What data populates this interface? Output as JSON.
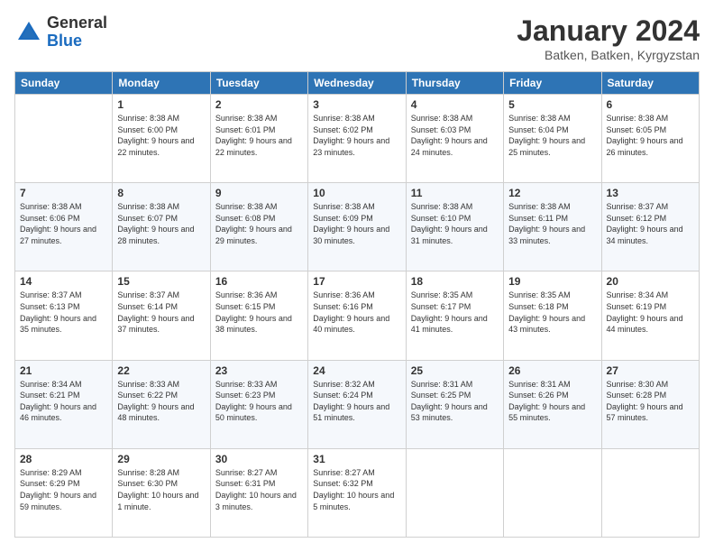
{
  "logo": {
    "general": "General",
    "blue": "Blue"
  },
  "header": {
    "title": "January 2024",
    "location": "Batken, Batken, Kyrgyzstan"
  },
  "weekdays": [
    "Sunday",
    "Monday",
    "Tuesday",
    "Wednesday",
    "Thursday",
    "Friday",
    "Saturday"
  ],
  "weeks": [
    [
      {
        "day": "",
        "sunrise": "",
        "sunset": "",
        "daylight": ""
      },
      {
        "day": "1",
        "sunrise": "Sunrise: 8:38 AM",
        "sunset": "Sunset: 6:00 PM",
        "daylight": "Daylight: 9 hours and 22 minutes."
      },
      {
        "day": "2",
        "sunrise": "Sunrise: 8:38 AM",
        "sunset": "Sunset: 6:01 PM",
        "daylight": "Daylight: 9 hours and 22 minutes."
      },
      {
        "day": "3",
        "sunrise": "Sunrise: 8:38 AM",
        "sunset": "Sunset: 6:02 PM",
        "daylight": "Daylight: 9 hours and 23 minutes."
      },
      {
        "day": "4",
        "sunrise": "Sunrise: 8:38 AM",
        "sunset": "Sunset: 6:03 PM",
        "daylight": "Daylight: 9 hours and 24 minutes."
      },
      {
        "day": "5",
        "sunrise": "Sunrise: 8:38 AM",
        "sunset": "Sunset: 6:04 PM",
        "daylight": "Daylight: 9 hours and 25 minutes."
      },
      {
        "day": "6",
        "sunrise": "Sunrise: 8:38 AM",
        "sunset": "Sunset: 6:05 PM",
        "daylight": "Daylight: 9 hours and 26 minutes."
      }
    ],
    [
      {
        "day": "7",
        "sunrise": "Sunrise: 8:38 AM",
        "sunset": "Sunset: 6:06 PM",
        "daylight": "Daylight: 9 hours and 27 minutes."
      },
      {
        "day": "8",
        "sunrise": "Sunrise: 8:38 AM",
        "sunset": "Sunset: 6:07 PM",
        "daylight": "Daylight: 9 hours and 28 minutes."
      },
      {
        "day": "9",
        "sunrise": "Sunrise: 8:38 AM",
        "sunset": "Sunset: 6:08 PM",
        "daylight": "Daylight: 9 hours and 29 minutes."
      },
      {
        "day": "10",
        "sunrise": "Sunrise: 8:38 AM",
        "sunset": "Sunset: 6:09 PM",
        "daylight": "Daylight: 9 hours and 30 minutes."
      },
      {
        "day": "11",
        "sunrise": "Sunrise: 8:38 AM",
        "sunset": "Sunset: 6:10 PM",
        "daylight": "Daylight: 9 hours and 31 minutes."
      },
      {
        "day": "12",
        "sunrise": "Sunrise: 8:38 AM",
        "sunset": "Sunset: 6:11 PM",
        "daylight": "Daylight: 9 hours and 33 minutes."
      },
      {
        "day": "13",
        "sunrise": "Sunrise: 8:37 AM",
        "sunset": "Sunset: 6:12 PM",
        "daylight": "Daylight: 9 hours and 34 minutes."
      }
    ],
    [
      {
        "day": "14",
        "sunrise": "Sunrise: 8:37 AM",
        "sunset": "Sunset: 6:13 PM",
        "daylight": "Daylight: 9 hours and 35 minutes."
      },
      {
        "day": "15",
        "sunrise": "Sunrise: 8:37 AM",
        "sunset": "Sunset: 6:14 PM",
        "daylight": "Daylight: 9 hours and 37 minutes."
      },
      {
        "day": "16",
        "sunrise": "Sunrise: 8:36 AM",
        "sunset": "Sunset: 6:15 PM",
        "daylight": "Daylight: 9 hours and 38 minutes."
      },
      {
        "day": "17",
        "sunrise": "Sunrise: 8:36 AM",
        "sunset": "Sunset: 6:16 PM",
        "daylight": "Daylight: 9 hours and 40 minutes."
      },
      {
        "day": "18",
        "sunrise": "Sunrise: 8:35 AM",
        "sunset": "Sunset: 6:17 PM",
        "daylight": "Daylight: 9 hours and 41 minutes."
      },
      {
        "day": "19",
        "sunrise": "Sunrise: 8:35 AM",
        "sunset": "Sunset: 6:18 PM",
        "daylight": "Daylight: 9 hours and 43 minutes."
      },
      {
        "day": "20",
        "sunrise": "Sunrise: 8:34 AM",
        "sunset": "Sunset: 6:19 PM",
        "daylight": "Daylight: 9 hours and 44 minutes."
      }
    ],
    [
      {
        "day": "21",
        "sunrise": "Sunrise: 8:34 AM",
        "sunset": "Sunset: 6:21 PM",
        "daylight": "Daylight: 9 hours and 46 minutes."
      },
      {
        "day": "22",
        "sunrise": "Sunrise: 8:33 AM",
        "sunset": "Sunset: 6:22 PM",
        "daylight": "Daylight: 9 hours and 48 minutes."
      },
      {
        "day": "23",
        "sunrise": "Sunrise: 8:33 AM",
        "sunset": "Sunset: 6:23 PM",
        "daylight": "Daylight: 9 hours and 50 minutes."
      },
      {
        "day": "24",
        "sunrise": "Sunrise: 8:32 AM",
        "sunset": "Sunset: 6:24 PM",
        "daylight": "Daylight: 9 hours and 51 minutes."
      },
      {
        "day": "25",
        "sunrise": "Sunrise: 8:31 AM",
        "sunset": "Sunset: 6:25 PM",
        "daylight": "Daylight: 9 hours and 53 minutes."
      },
      {
        "day": "26",
        "sunrise": "Sunrise: 8:31 AM",
        "sunset": "Sunset: 6:26 PM",
        "daylight": "Daylight: 9 hours and 55 minutes."
      },
      {
        "day": "27",
        "sunrise": "Sunrise: 8:30 AM",
        "sunset": "Sunset: 6:28 PM",
        "daylight": "Daylight: 9 hours and 57 minutes."
      }
    ],
    [
      {
        "day": "28",
        "sunrise": "Sunrise: 8:29 AM",
        "sunset": "Sunset: 6:29 PM",
        "daylight": "Daylight: 9 hours and 59 minutes."
      },
      {
        "day": "29",
        "sunrise": "Sunrise: 8:28 AM",
        "sunset": "Sunset: 6:30 PM",
        "daylight": "Daylight: 10 hours and 1 minute."
      },
      {
        "day": "30",
        "sunrise": "Sunrise: 8:27 AM",
        "sunset": "Sunset: 6:31 PM",
        "daylight": "Daylight: 10 hours and 3 minutes."
      },
      {
        "day": "31",
        "sunrise": "Sunrise: 8:27 AM",
        "sunset": "Sunset: 6:32 PM",
        "daylight": "Daylight: 10 hours and 5 minutes."
      },
      {
        "day": "",
        "sunrise": "",
        "sunset": "",
        "daylight": ""
      },
      {
        "day": "",
        "sunrise": "",
        "sunset": "",
        "daylight": ""
      },
      {
        "day": "",
        "sunrise": "",
        "sunset": "",
        "daylight": ""
      }
    ]
  ]
}
